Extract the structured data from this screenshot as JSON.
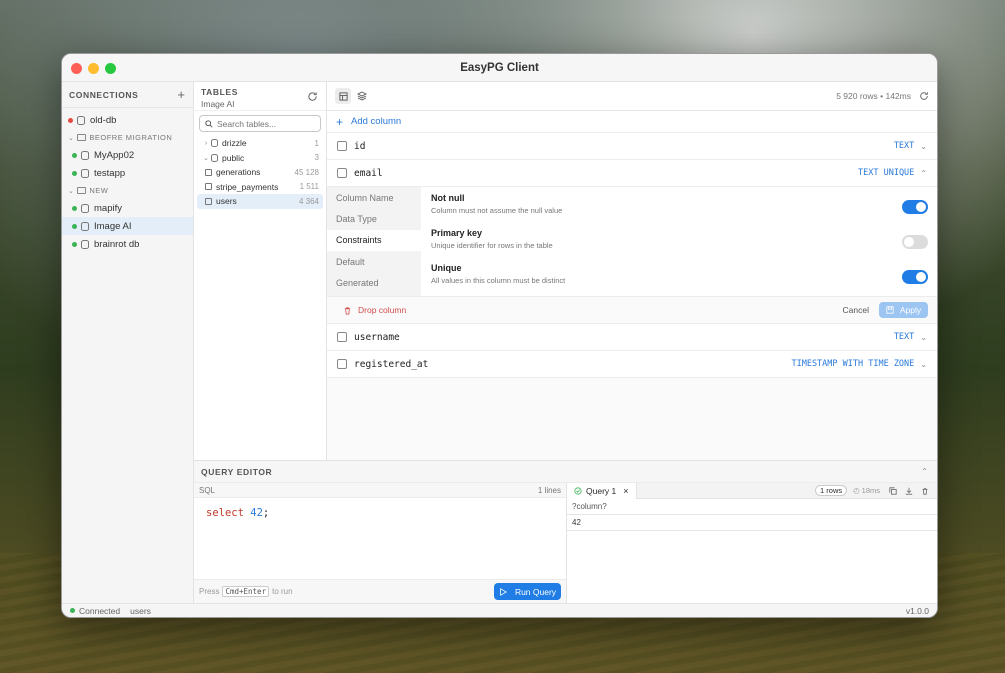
{
  "window": {
    "title": "EasyPG Client"
  },
  "connections": {
    "header": "CONNECTIONS",
    "items": [
      {
        "type": "conn",
        "label": "old-db",
        "status": "#e5483e",
        "indent": false
      },
      {
        "type": "folder",
        "label": "BEOFRE MIGRATION"
      },
      {
        "type": "conn",
        "label": "MyApp02",
        "status": "#3ab454",
        "indent": true
      },
      {
        "type": "conn",
        "label": "testapp",
        "status": "#3ab454",
        "indent": true
      },
      {
        "type": "folder",
        "label": "NEW"
      },
      {
        "type": "conn",
        "label": "mapify",
        "status": "#3ab454",
        "indent": true
      },
      {
        "type": "conn",
        "label": "Image AI",
        "status": "#3ab454",
        "indent": true,
        "active": true
      },
      {
        "type": "conn",
        "label": "brainrot db",
        "status": "#3ab454",
        "indent": true
      }
    ]
  },
  "tables": {
    "header": "TABLES",
    "subtitle": "Image AI",
    "search_placeholder": "Search tables...",
    "items": [
      {
        "kind": "schema",
        "label": "drizzle",
        "count": "1",
        "expanded": false
      },
      {
        "kind": "schema",
        "label": "public",
        "count": "3",
        "expanded": true
      },
      {
        "kind": "table",
        "label": "generations",
        "count": "45 128"
      },
      {
        "kind": "table",
        "label": "stripe_payments",
        "count": "1 511"
      },
      {
        "kind": "table",
        "label": "users",
        "count": "4 364",
        "selected": true
      }
    ]
  },
  "main": {
    "row_info": "5 920 rows • 142ms",
    "add_column": "Add column",
    "columns": [
      {
        "name": "id",
        "type": "TEXT"
      },
      {
        "name": "email",
        "type": "TEXT UNIQUE",
        "expanded": true
      },
      {
        "name": "username",
        "type": "TEXT"
      },
      {
        "name": "registered_at",
        "type": "TIMESTAMP WITH TIME ZONE"
      }
    ],
    "detail_tabs": [
      "Column Name",
      "Data Type",
      "Constraints",
      "Default",
      "Generated"
    ],
    "active_tab": 2,
    "constraints": [
      {
        "title": "Not null",
        "desc": "Column must not assume the null value",
        "on": true
      },
      {
        "title": "Primary key",
        "desc": "Unique identifier for rows in the table",
        "on": false
      },
      {
        "title": "Unique",
        "desc": "All values in this column must be distinct",
        "on": true
      }
    ],
    "drop_column": "Drop column",
    "cancel": "Cancel",
    "apply": "Apply"
  },
  "query_editor": {
    "header": "QUERY EDITOR",
    "sql_label": "SQL",
    "lines": "1 lines",
    "code_keyword": "select",
    "code_number": "42",
    "code_end": ";",
    "hint_press": "Press",
    "hint_key": "Cmd+Enter",
    "hint_run": "to run",
    "run_button": "Run Query",
    "result_tab": "Query 1",
    "rows_badge": "1 rows",
    "time": "18ms",
    "result_header": "?column?",
    "result_value": "42"
  },
  "status": {
    "connected": "Connected",
    "table": "users",
    "version": "v1.0.0"
  },
  "colors": {
    "accent": "#1f7de5",
    "danger": "#d24b4b",
    "ok": "#3ab454"
  }
}
